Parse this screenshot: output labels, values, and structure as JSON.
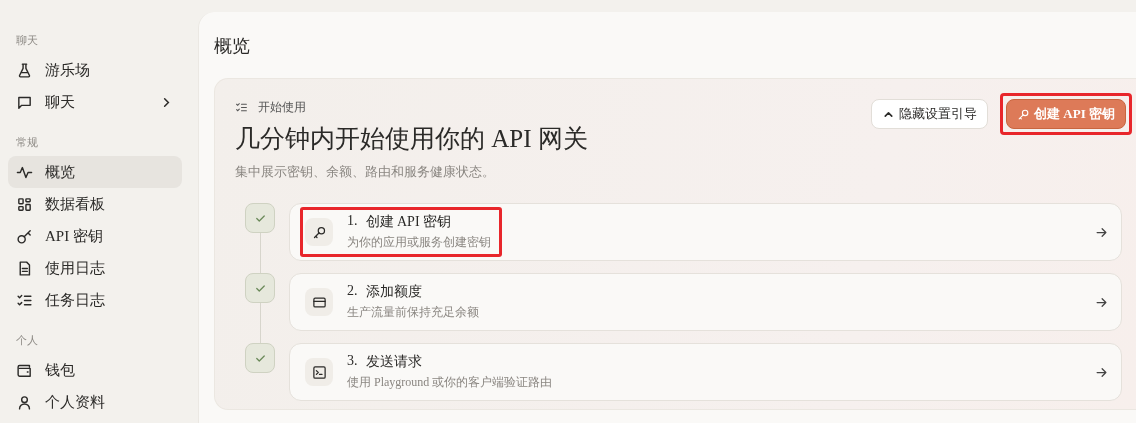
{
  "sidebar": {
    "sections": [
      {
        "label": "聊天",
        "items": [
          {
            "label": "游乐场",
            "selected": false,
            "expandable": false
          },
          {
            "label": "聊天",
            "selected": false,
            "expandable": true
          }
        ]
      },
      {
        "label": "常规",
        "items": [
          {
            "label": "概览",
            "selected": true,
            "expandable": false
          },
          {
            "label": "数据看板",
            "selected": false,
            "expandable": false
          },
          {
            "label": "API 密钥",
            "selected": false,
            "expandable": false
          },
          {
            "label": "使用日志",
            "selected": false,
            "expandable": false
          },
          {
            "label": "任务日志",
            "selected": false,
            "expandable": false
          }
        ]
      },
      {
        "label": "个人",
        "items": [
          {
            "label": "钱包",
            "selected": false,
            "expandable": false
          },
          {
            "label": "个人资料",
            "selected": false,
            "expandable": false
          }
        ]
      }
    ]
  },
  "page_title": "概览",
  "card": {
    "eyebrow": "开始使用",
    "title": "几分钟内开始使用你的 API 网关",
    "subtitle": "集中展示密钥、余额、路由和服务健康状态。",
    "buttons": [
      {
        "label": "隐藏设置引导",
        "kind": "secondary",
        "highlighted": false
      },
      {
        "label": "创建 API 密钥",
        "kind": "primary",
        "highlighted": true
      }
    ],
    "steps": [
      {
        "number": "1.",
        "title": "创建 API 密钥",
        "subtitle": "为你的应用或服务创建密钥",
        "done": true,
        "highlighted": true
      },
      {
        "number": "2.",
        "title": "添加额度",
        "subtitle": "生产流量前保持充足余额",
        "done": true,
        "highlighted": false
      },
      {
        "number": "3.",
        "title": "发送请求",
        "subtitle": "使用 Playground 或你的客户端验证路由",
        "done": true,
        "highlighted": false
      }
    ]
  }
}
